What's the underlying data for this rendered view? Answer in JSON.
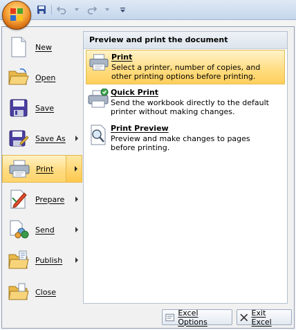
{
  "quick_access": {
    "icons": [
      "save-icon",
      "undo-icon",
      "redo-icon",
      "customize-qat-icon"
    ]
  },
  "menu": {
    "items": [
      {
        "label": "New",
        "icon": "new-document-icon",
        "has_submenu": false
      },
      {
        "label": "Open",
        "icon": "open-folder-icon",
        "has_submenu": false
      },
      {
        "label": "Save",
        "icon": "save-disk-icon",
        "has_submenu": false
      },
      {
        "label": "Save As",
        "icon": "save-as-icon",
        "has_submenu": true
      },
      {
        "label": "Print",
        "icon": "printer-icon",
        "has_submenu": true,
        "active": true
      },
      {
        "label": "Prepare",
        "icon": "prepare-icon",
        "has_submenu": true
      },
      {
        "label": "Send",
        "icon": "send-icon",
        "has_submenu": true
      },
      {
        "label": "Publish",
        "icon": "publish-icon",
        "has_submenu": true
      },
      {
        "label": "Close",
        "icon": "close-folder-icon",
        "has_submenu": false
      }
    ]
  },
  "submenu": {
    "title": "Preview and print the document",
    "items": [
      {
        "title": "Print",
        "description": "Select a printer, number of copies, and other printing options before printing.",
        "icon": "printer-icon",
        "highlighted": true
      },
      {
        "title": "Quick Print",
        "description": "Send the workbook directly to the default printer without making changes.",
        "icon": "quick-print-icon",
        "highlighted": false
      },
      {
        "title": "Print Preview",
        "description": "Preview and make changes to pages before printing.",
        "icon": "print-preview-icon",
        "highlighted": false
      }
    ]
  },
  "footer": {
    "options_label": "Excel Options",
    "exit_label": "Exit Excel"
  },
  "colors": {
    "highlight_top": "#fff2c6",
    "highlight_bottom": "#ffd46b",
    "highlight_border": "#e4b84a",
    "orb": "#f7a33a"
  }
}
